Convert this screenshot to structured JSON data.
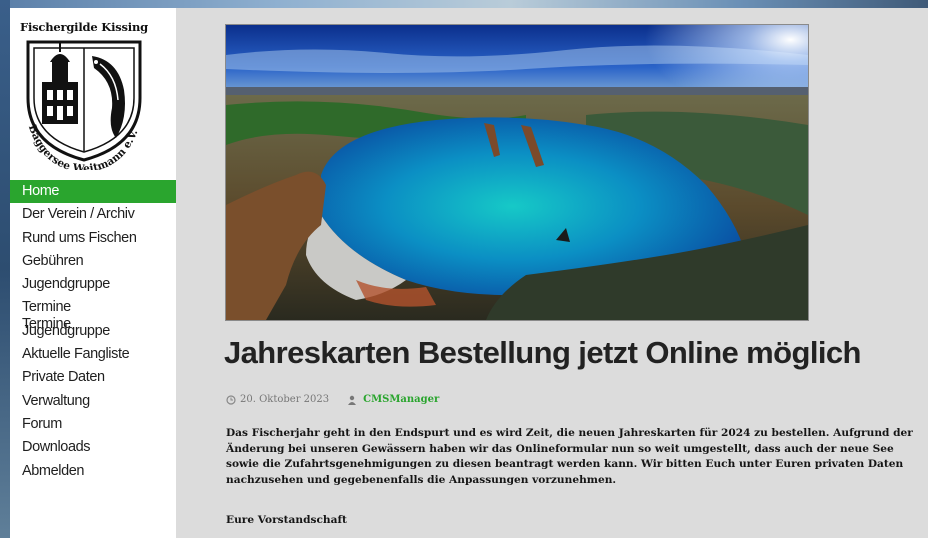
{
  "logo": {
    "title": "Fischergilde Kissing",
    "ring_text": "Baggersee Weitmann e.V."
  },
  "nav": {
    "items": [
      {
        "label": "Home",
        "active": true
      },
      {
        "label": "Der Verein / Archiv"
      },
      {
        "label": "Rund ums Fischen"
      },
      {
        "label": "Gebühren"
      },
      {
        "label": "Jugendgruppe"
      },
      {
        "label": "Termine"
      },
      {
        "label": "Termine Jugendgruppe"
      },
      {
        "label": "Aktuelle Fangliste"
      },
      {
        "label": "Private Daten"
      },
      {
        "label": "Verwaltung"
      },
      {
        "label": "Forum"
      },
      {
        "label": "Downloads"
      },
      {
        "label": "Abmelden"
      }
    ],
    "overlap_ghost": "Termine",
    "overlap_main": "Jugendgruppe"
  },
  "post": {
    "title": "Jahreskarten Bestellung jetzt Online möglich",
    "date": "20. Oktober 2023",
    "author": "CMSManager",
    "body": "Das Fischerjahr geht in den Endspurt und es wird Zeit, die neuen Jahreskarten für 2024 zu bestellen. Aufgrund der Änderung bei unseren Gewässern haben wir das Onlineformular nun so weit umgestellt, dass auch der neue See sowie die Zufahrtsgenehmigungen zu diesen beantragt werden kann. Wir bitten Euch unter Euren privaten Daten nachzusehen und gegebenenfalls die Anpassungen vorzunehmen.",
    "signoff": "Eure Vorstandschaft"
  },
  "colors": {
    "accent": "#2aa52e",
    "content_bg": "#dcdcdc",
    "sidebar_bg": "#ffffff"
  }
}
